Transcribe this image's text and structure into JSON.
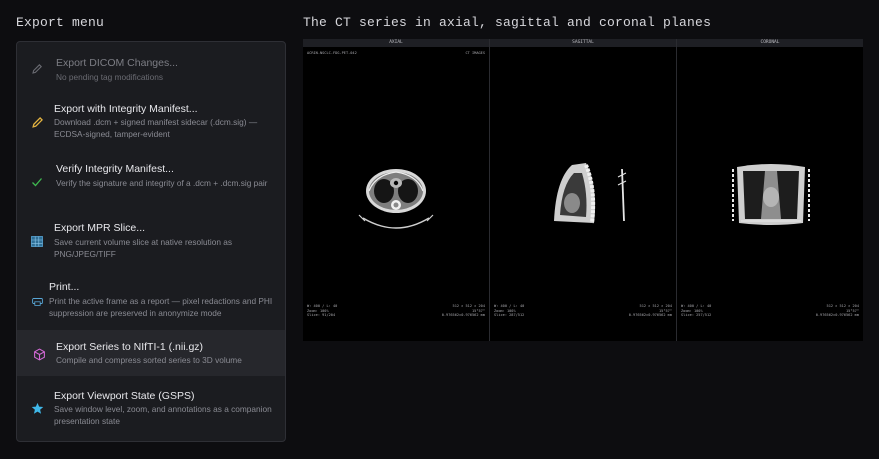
{
  "left_heading": "Export menu",
  "right_heading": "The CT series in axial, sagittal and coronal planes",
  "menu": [
    {
      "title": "Export DICOM Changes...",
      "desc": "No pending tag modifications",
      "icon": "pencil-icon",
      "disabled": true
    },
    {
      "title": "Export with Integrity Manifest...",
      "desc": "Download .dcm + signed manifest sidecar (.dcm.sig) — ECDSA-signed, tamper-evident",
      "icon": "pencil-icon",
      "color": "#e3b341"
    },
    {
      "title": "Verify Integrity Manifest...",
      "desc": "Verify the signature and integrity of a .dcm + .dcm.sig pair",
      "icon": "check-icon",
      "color": "#3fb950"
    },
    {
      "title": "Export MPR Slice...",
      "desc": "Save current volume slice at native resolution as PNG/JPEG/TIFF",
      "icon": "grid-icon",
      "color": "#58a6d6"
    },
    {
      "title": "Print...",
      "desc": "Print the active frame as a report — pixel redactions and PHI suppression are preserved in anonymize mode",
      "icon": "printer-icon",
      "color": "#58a6d6"
    },
    {
      "title": "Export Series to NIfTI-1 (.nii.gz)",
      "desc": "Compile and compress sorted series to 3D volume",
      "icon": "cube-icon",
      "color": "#d56ad8",
      "highlighted": true
    },
    {
      "title": "Export Viewport State (GSPS)",
      "desc": "Save window level, zoom, and annotations as a companion presentation state",
      "icon": "star-icon",
      "color": "#3fb7e8"
    }
  ],
  "viewports": [
    {
      "label": "AXIAL",
      "top_left": "ACRIN-NSCLC-FDG-PET-042",
      "top_right": "CT IMAGES",
      "bottom_left": "W: 400 / L: 40\nZoom: 100%\nSlice: 91/204",
      "bottom_right": "512 × 512 × 204\n15°57°\n0.976562×0.976562 mm"
    },
    {
      "label": "SAGITTAL",
      "top_left": "",
      "top_right": "",
      "bottom_left": "W: 400 / L: 40\nZoom: 100%\nSlice: 287/512",
      "bottom_right": "512 × 512 × 204\n15°57°\n0.976562×0.976562 mm"
    },
    {
      "label": "CORONAL",
      "top_left": "",
      "top_right": "",
      "bottom_left": "W: 400 / L: 40\nZoom: 100%\nSlice: 257/512",
      "bottom_right": "512 × 512 × 204\n15°57°\n0.976562×0.976562 mm"
    }
  ]
}
